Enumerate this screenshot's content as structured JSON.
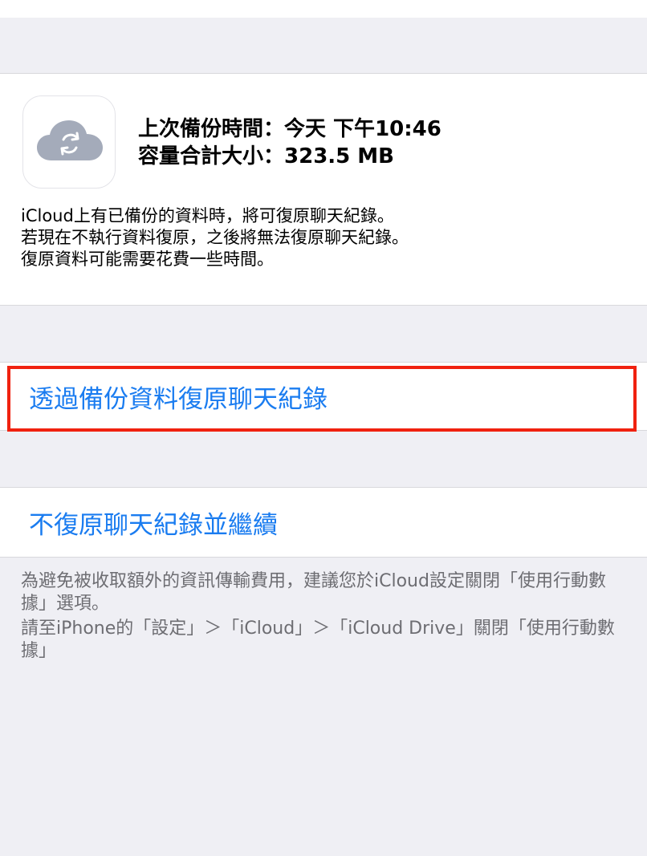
{
  "backup_info": {
    "icon": "icloud-sync-icon",
    "last_backup_label": "上次備份時間：今天 下午",
    "last_backup_time": "10:46",
    "size_label": "容量合計大小：",
    "size_value": "323.5 MB",
    "description_lines": [
      "iCloud上有已備份的資料時，將可復原聊天紀錄。",
      "若現在不執行資料復原，之後將無法復原聊天紀錄。",
      "復原資料可能需要花費一些時間。"
    ]
  },
  "actions": {
    "restore_label": "透過備份資料復原聊天紀錄",
    "skip_label": "不復原聊天紀錄並繼續"
  },
  "footer": {
    "note1": "為避免被收取額外的資訊傳輸費用，建議您於iCloud設定關閉「使用行動數據」選項。",
    "note2": "請至iPhone的「設定」＞「iCloud」＞「iCloud Drive」關閉「使用行動數據」"
  },
  "colors": {
    "link": "#1a7cf0",
    "highlight": "#f0210f",
    "background": "#efeff4",
    "icon_cloud": "#a4abba"
  }
}
